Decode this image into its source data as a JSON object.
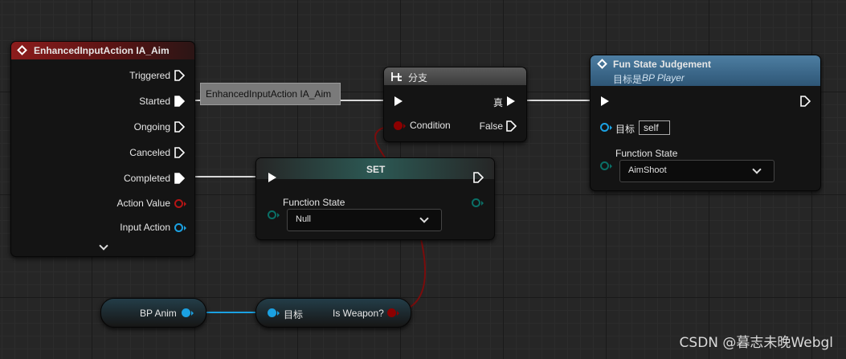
{
  "nodes": {
    "input_action": {
      "title": "EnhancedInputAction IA_Aim",
      "outputs": [
        "Triggered",
        "Started",
        "Ongoing",
        "Canceled",
        "Completed",
        "Action Value",
        "Input Action"
      ],
      "expand_icon": "chevron-down-icon"
    },
    "tooltip": {
      "text": "EnhancedInputAction IA_Aim"
    },
    "branch": {
      "title": "分支",
      "condition_label": "Condition",
      "true_label": "真",
      "false_label": "False"
    },
    "fun_state": {
      "title": "Fun State Judgement",
      "subtitle_prefix": "目标是",
      "subtitle_target": "BP Player",
      "target_label": "目标",
      "target_value": "self",
      "param_label": "Function State",
      "param_value": "AimShoot"
    },
    "set": {
      "title": "SET",
      "param_label": "Function State",
      "param_value": "Null"
    },
    "bp_anim": {
      "title": "BP Anim"
    },
    "is_weapon": {
      "target_label": "目标",
      "output_label": "Is Weapon?"
    }
  },
  "colors": {
    "exec": "#ffffff",
    "object_pin": "#1ba1e2",
    "bool_pin": "#8c0000",
    "byte_pin": "#0a6f66",
    "event_header": "#8c1c1c",
    "function_header": "#4d7ea2"
  },
  "watermark": "CSDN @暮志未晚Webgl"
}
